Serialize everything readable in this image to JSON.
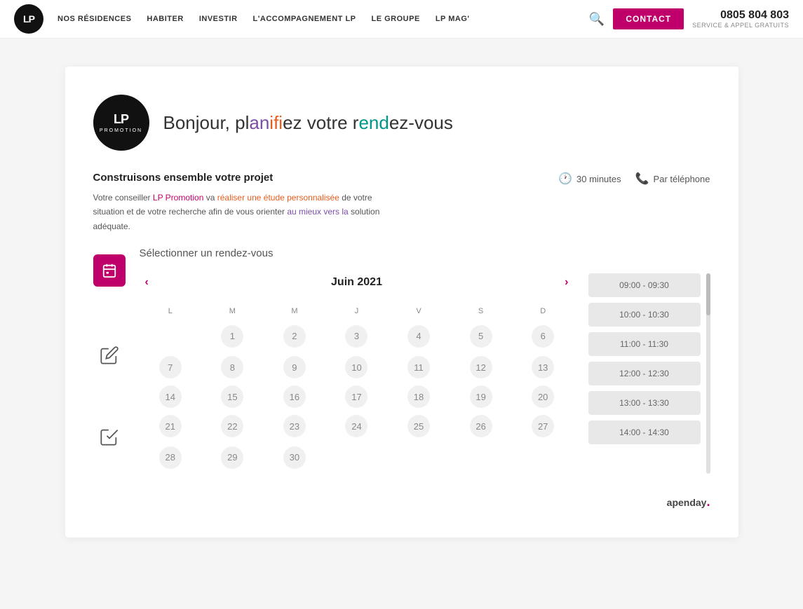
{
  "navbar": {
    "logo_text": "LP",
    "links": [
      {
        "label": "NOS RÉSIDENCES"
      },
      {
        "label": "HABITER"
      },
      {
        "label": "INVESTIR"
      },
      {
        "label": "L'ACCOMPAGNEMENT LP"
      },
      {
        "label": "LE GROUPE"
      },
      {
        "label": "LP MAG'"
      }
    ],
    "contact_label": "CONTACT",
    "phone": "0805 804 803",
    "phone_sub": "SERVICE & APPEL GRATUITS"
  },
  "header": {
    "logo_lp": "LP",
    "logo_promo": "PROMOTION",
    "greeting": {
      "prefix": "Bonjour, pl",
      "span1": "an",
      "span1b": "ifi",
      "span2": "ez votre r",
      "span3": "end",
      "span4": "ez-vous"
    },
    "greeting_full": "Bonjour, planifiez votre rendez-vous"
  },
  "project": {
    "title": "Construisons ensemble votre projet",
    "description_parts": [
      "Votre conseiller ",
      "LP Promotion",
      " va ",
      "réaliser une étude personnalisée",
      " de votre situation et de votre recherche afin de vous orienter ",
      "au mieux vers la",
      " solution adéquate."
    ],
    "duration_icon": "clock",
    "duration": "30 minutes",
    "phone_icon": "phone",
    "phone_label": "Par téléphone"
  },
  "scheduler": {
    "section_title": "Sélectionner un rendez-vous",
    "calendar": {
      "prev_label": "‹",
      "next_label": "›",
      "month_year": "Juin 2021",
      "day_headers": [
        "L",
        "M",
        "M",
        "J",
        "V",
        "S",
        "D"
      ],
      "weeks": [
        [
          "",
          "1",
          "2",
          "3",
          "4",
          "5",
          "6"
        ],
        [
          "7",
          "8",
          "9",
          "10",
          "11",
          "12",
          "13"
        ],
        [
          "14",
          "15",
          "16",
          "17",
          "18",
          "19",
          "20"
        ],
        [
          "21",
          "22",
          "23",
          "24",
          "25",
          "26",
          "27"
        ],
        [
          "28",
          "29",
          "30",
          "",
          "",
          "",
          ""
        ]
      ],
      "selected_day": "4"
    },
    "time_slots": [
      "09:00 - 09:30",
      "10:00 - 10:30",
      "11:00 - 11:30",
      "12:00 - 12:30",
      "13:00 - 13:30",
      "14:00 - 14:30"
    ]
  },
  "footer": {
    "brand": "apenday",
    "dot": "."
  }
}
